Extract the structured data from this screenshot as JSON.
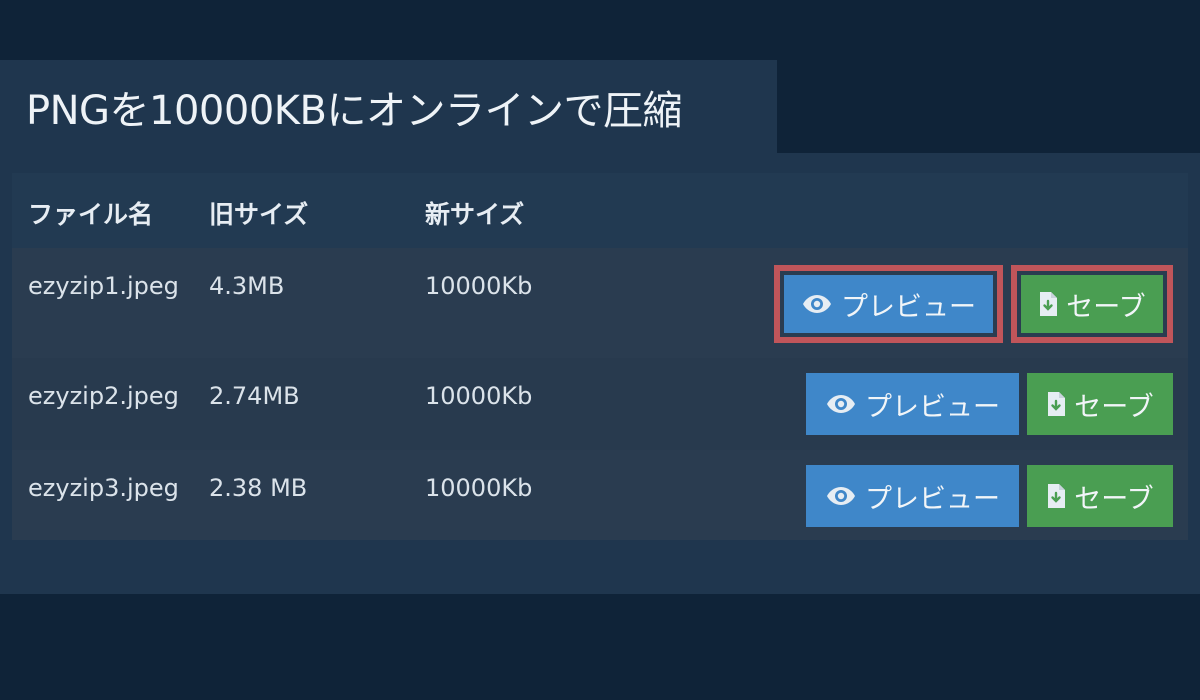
{
  "page": {
    "title": "PNGを10000KBにオンラインで圧縮"
  },
  "table": {
    "headers": {
      "file_name": "ファイル名",
      "old_size": "旧サイズ",
      "new_size": "新サイズ"
    },
    "rows": [
      {
        "file_name": "ezyzip1.jpeg",
        "old_size": "4.3MB",
        "new_size": "10000Kb",
        "preview_label": "プレビュー",
        "save_label": "セーブ"
      },
      {
        "file_name": "ezyzip2.jpeg",
        "old_size": "2.74MB",
        "new_size": "10000Kb",
        "preview_label": "プレビュー",
        "save_label": "セーブ"
      },
      {
        "file_name": "ezyzip3.jpeg",
        "old_size": "2.38 MB",
        "new_size": "10000Kb",
        "preview_label": "プレビュー",
        "save_label": "セーブ"
      }
    ]
  },
  "colors": {
    "background": "#0f2338",
    "panel": "#1f364e",
    "row": "#2a3c50",
    "preview_button": "#3f87c9",
    "save_button": "#4a9e52",
    "highlight": "#c0555a"
  },
  "icons": {
    "preview": "eye-icon",
    "save": "file-download-icon"
  }
}
